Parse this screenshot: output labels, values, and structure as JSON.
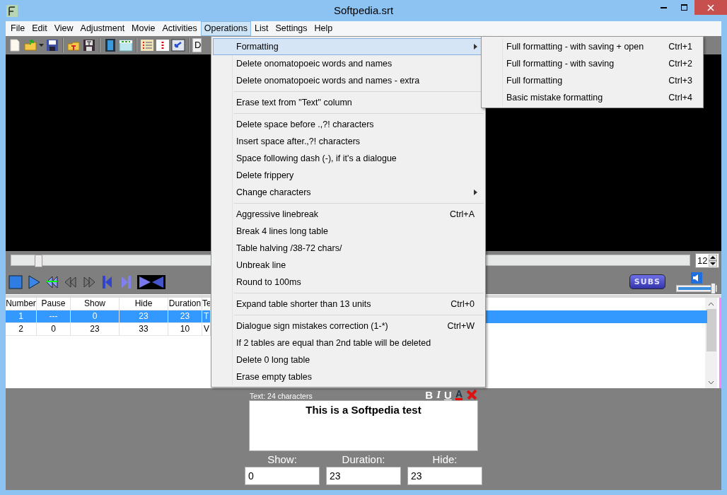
{
  "window": {
    "title": "Softpedia.srt"
  },
  "menubar": [
    {
      "label": "File",
      "selected": false
    },
    {
      "label": "Edit",
      "selected": false
    },
    {
      "label": "View",
      "selected": false
    },
    {
      "label": "Adjustment",
      "selected": false
    },
    {
      "label": "Movie",
      "selected": false
    },
    {
      "label": "Activities",
      "selected": false
    },
    {
      "label": "Operations",
      "selected": true
    },
    {
      "label": "List",
      "selected": false
    },
    {
      "label": "Settings",
      "selected": false
    },
    {
      "label": "Help",
      "selected": false
    }
  ],
  "toolbar": {
    "combo_text": "D"
  },
  "video": {
    "position": {
      "level": 0.04
    },
    "font_size": "12",
    "volume": {
      "level": 0.95
    },
    "subs_button": "SUBS"
  },
  "table": {
    "columns": [
      "Number",
      "Pause",
      "Show",
      "Hide",
      "Duration",
      "Te"
    ],
    "rows": [
      {
        "cells": [
          "1",
          "---",
          "0",
          "23",
          "23",
          "T"
        ],
        "selected": true
      },
      {
        "cells": [
          "2",
          "0",
          "23",
          "33",
          "10",
          "V"
        ],
        "selected": false
      }
    ]
  },
  "editor": {
    "info": "Text: 24 characters",
    "format_buttons": [
      "B",
      "I",
      "U",
      "A"
    ],
    "text": "This is a Softpedia test",
    "fields": [
      {
        "label": "Show:",
        "value": "0"
      },
      {
        "label": "Duration:",
        "value": "23"
      },
      {
        "label": "Hide:",
        "value": "23"
      }
    ]
  },
  "operations_menu": {
    "groups": [
      [
        {
          "label": "Formatting",
          "submenu": true,
          "selected": true
        },
        {
          "label": "Delete onomatopoeic words and names",
          "selected": false
        },
        {
          "label": "Delete onomatopoeic words and names - extra",
          "selected": false
        }
      ],
      [
        {
          "label": "Erase text from \"Text\" column",
          "selected": false
        }
      ],
      [
        {
          "label": "Delete space before .,?! characters",
          "selected": false
        },
        {
          "label": "Insert space after.,?! characters",
          "selected": false
        },
        {
          "label": "Space following dash (-), if it's a dialogue",
          "selected": false
        },
        {
          "label": "Delete frippery",
          "selected": false
        },
        {
          "label": "Change characters",
          "submenu": true,
          "selected": false
        }
      ],
      [
        {
          "label": "Aggressive linebreak",
          "shortcut": "Ctrl+A",
          "selected": false
        },
        {
          "label": "Break 4 lines long table",
          "selected": false
        },
        {
          "label": "Table halving /38-72 chars/",
          "selected": false
        },
        {
          "label": "Unbreak line",
          "selected": false
        },
        {
          "label": "Round to 100ms",
          "selected": false
        }
      ],
      [
        {
          "label": "Expand table shorter than 13 units",
          "shortcut": "Ctrl+0",
          "selected": false
        }
      ],
      [
        {
          "label": "Dialogue sign mistakes correction (1-*)",
          "shortcut": "Ctrl+W",
          "selected": false
        },
        {
          "label": "If 2 tables are equal than 2nd table will be deleted",
          "selected": false
        },
        {
          "label": "Delete 0 long table",
          "selected": false
        },
        {
          "label": "Erase empty tables",
          "selected": false
        }
      ]
    ]
  },
  "formatting_submenu": {
    "items": [
      {
        "label": "Full formatting - with saving + open",
        "shortcut": "Ctrl+1",
        "selected": false
      },
      {
        "label": "Full formatting - with saving",
        "shortcut": "Ctrl+2",
        "selected": false
      },
      {
        "label": "Full formatting",
        "shortcut": "Ctrl+3",
        "selected": false
      },
      {
        "label": "Basic mistake formatting",
        "shortcut": "Ctrl+4",
        "selected": false
      }
    ]
  }
}
